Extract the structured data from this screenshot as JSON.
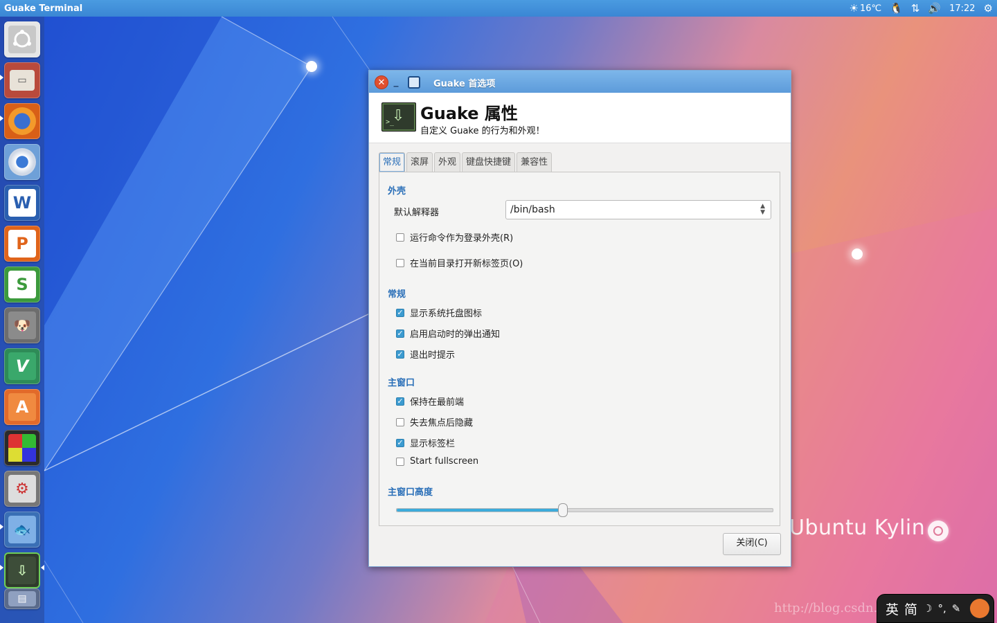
{
  "top_panel": {
    "app_title": "Guake Terminal",
    "weather_temp": "16℃",
    "clock": "17:22",
    "icons": [
      "sun-icon",
      "tux-icon",
      "network-arrows-icon",
      "volume-icon",
      "gear-icon"
    ]
  },
  "launcher": {
    "items": [
      {
        "name": "dash-ubuntu",
        "color": "#d7d7d7"
      },
      {
        "name": "files",
        "color": "#b94a3c"
      },
      {
        "name": "firefox",
        "color": "#e36d1c"
      },
      {
        "name": "chromium",
        "color": "#6ea0d8"
      },
      {
        "name": "wps-writer",
        "color": "#2a5fb0",
        "glyph": "W"
      },
      {
        "name": "wps-presentation",
        "color": "#e0641b",
        "glyph": "P"
      },
      {
        "name": "wps-spreadsheets",
        "color": "#3c9a3c",
        "glyph": "S"
      },
      {
        "name": "gimp",
        "color": "#6d6d6d"
      },
      {
        "name": "vim",
        "color": "#2e8b57",
        "glyph": "V"
      },
      {
        "name": "software-center",
        "color": "#e26a2a",
        "glyph": "A"
      },
      {
        "name": "windows-app",
        "color": "#3a3a3a"
      },
      {
        "name": "system-settings",
        "color": "#777777"
      },
      {
        "name": "fish-app",
        "color": "#3a6fb5"
      },
      {
        "name": "guake",
        "color": "#2f3b2c"
      },
      {
        "name": "scanner",
        "color": "#5a6a8a"
      }
    ]
  },
  "dialog": {
    "title": "Guake 首选项",
    "header_title": "Guake 属性",
    "header_subtitle": "自定义 Guake 的行为和外观！",
    "tabs": [
      "常规",
      "滚屏",
      "外观",
      "键盘快捷键",
      "兼容性"
    ],
    "active_tab": "常规",
    "section_shell": "外壳",
    "default_interpreter_label": "默认解释器",
    "default_interpreter_value": "/bin/bash",
    "shell_checks": [
      {
        "label": "运行命令作为登录外壳(R)",
        "checked": false
      },
      {
        "label": "在当前目录打开新标签页(O)",
        "checked": false
      }
    ],
    "section_general": "常规",
    "general_checks": [
      {
        "label": "显示系统托盘图标",
        "checked": true
      },
      {
        "label": "启用启动时的弹出通知",
        "checked": true
      },
      {
        "label": "退出时提示",
        "checked": true
      }
    ],
    "section_main_window": "主窗口",
    "main_window_checks": [
      {
        "label": "保持在最前端",
        "checked": true
      },
      {
        "label": "失去焦点后隐藏",
        "checked": false
      },
      {
        "label": "显示标签栏",
        "checked": true
      },
      {
        "label": "Start fullscreen",
        "checked": false
      }
    ],
    "section_height": "主窗口高度",
    "height_fraction": 0.44,
    "close_button": "关闭(C)"
  },
  "desktop": {
    "wallpaper_text": "Ubuntu Kylin",
    "watermark": "http://blog.csdn.net/2016"
  },
  "input_method": {
    "lang": "英",
    "mode": "简"
  }
}
